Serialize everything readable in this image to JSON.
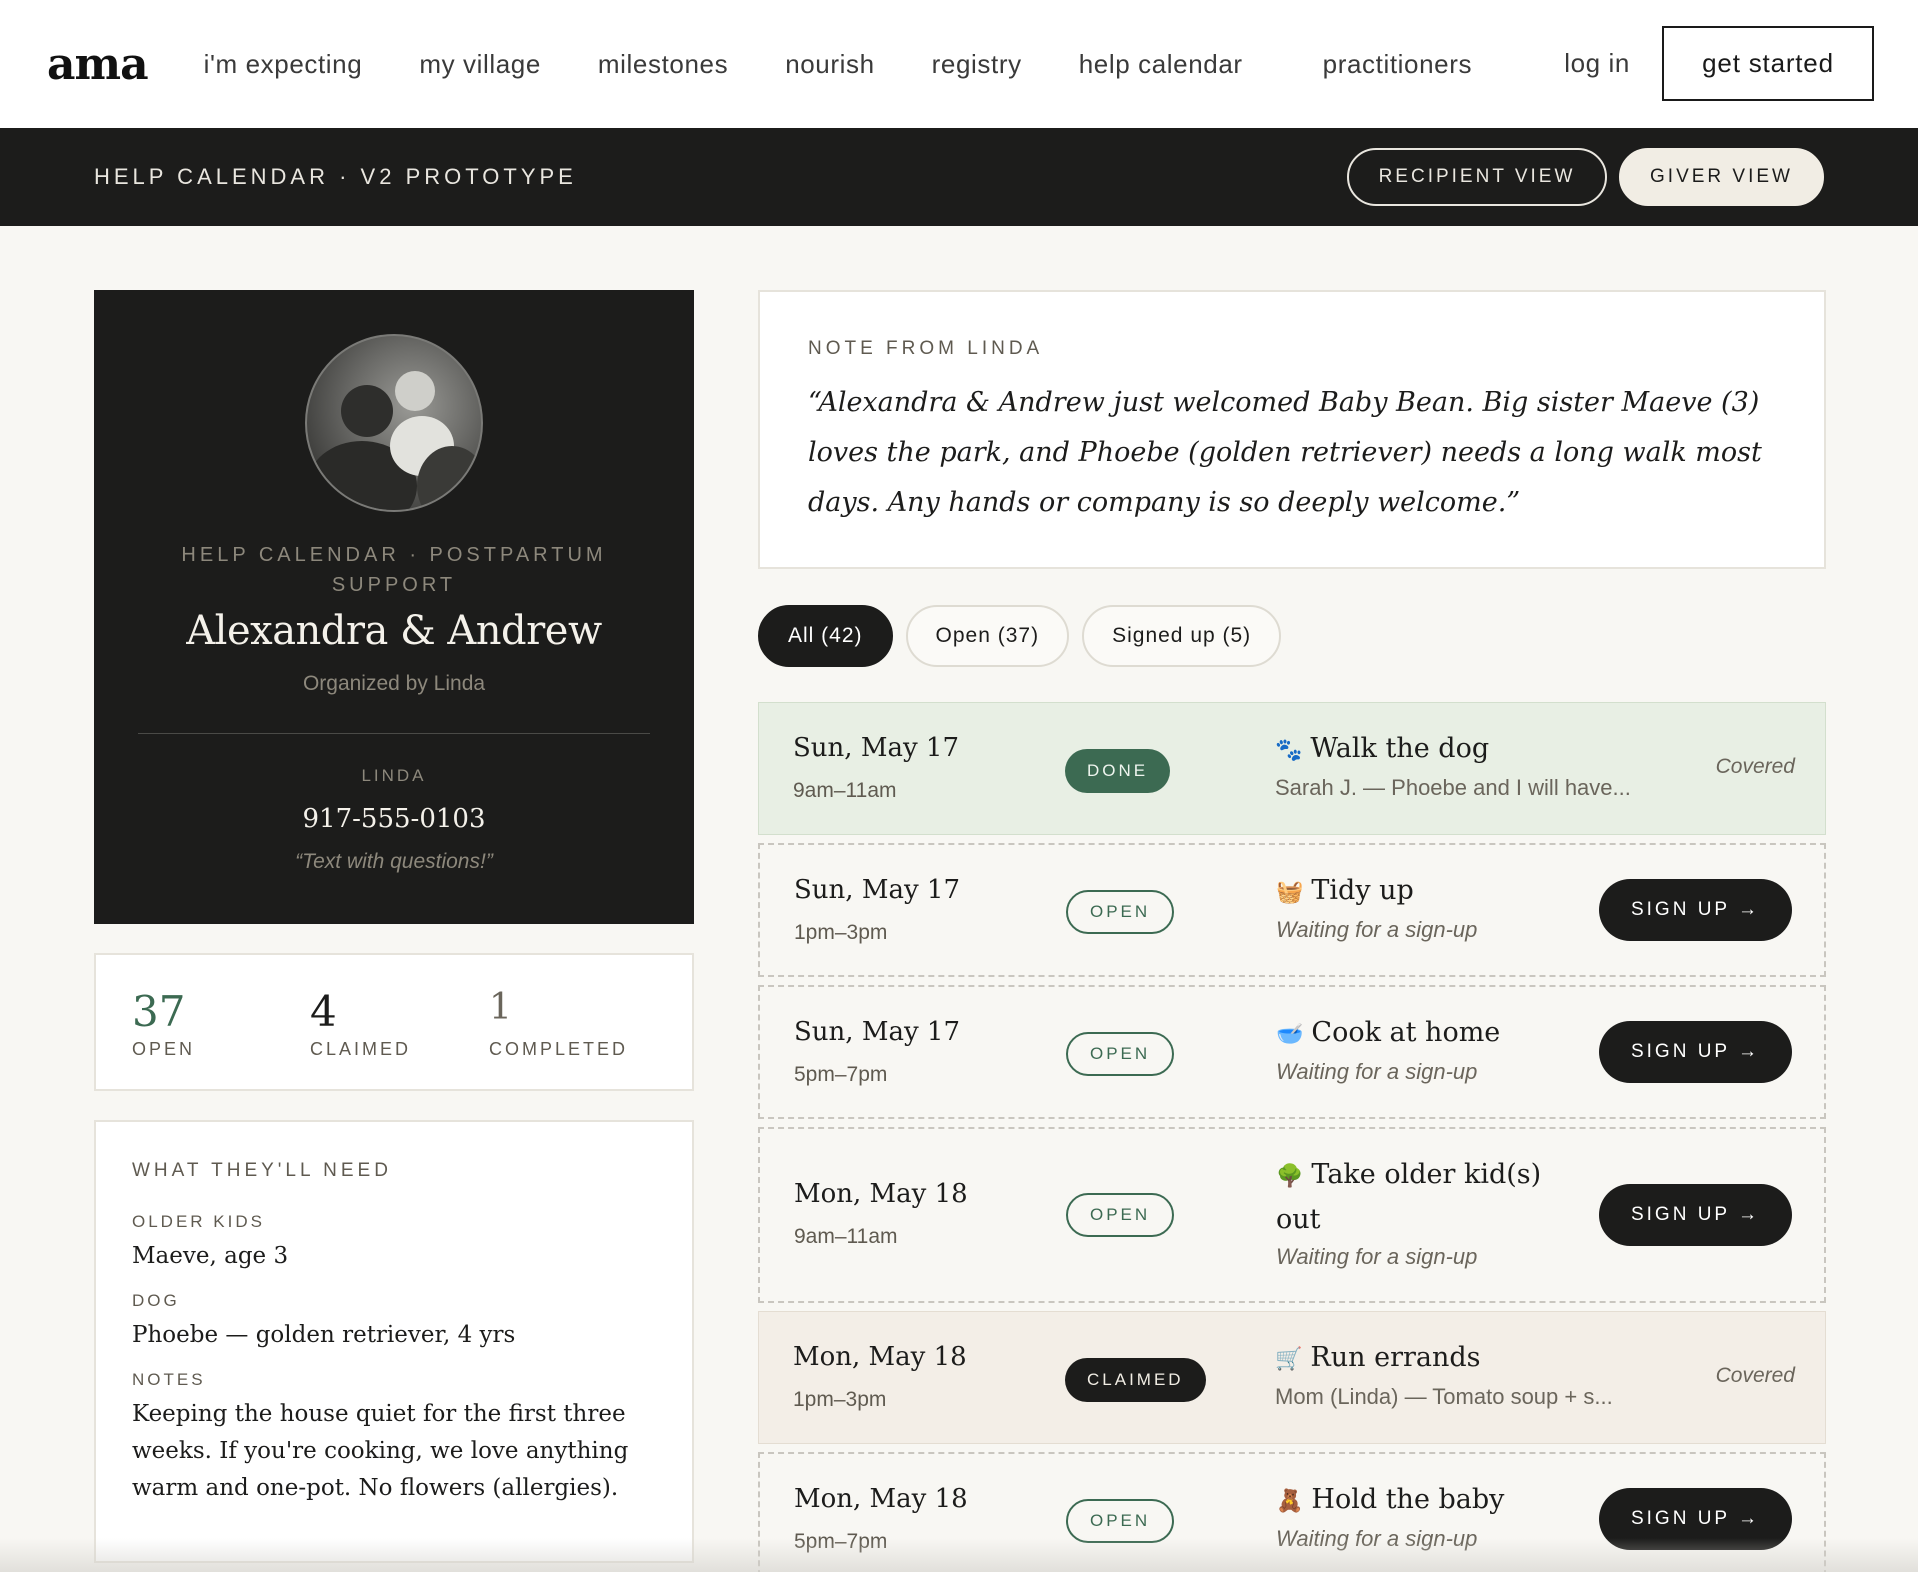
{
  "nav": {
    "logo": "ama",
    "links": [
      "i'm expecting",
      "my village",
      "milestones",
      "nourish",
      "registry",
      "help calendar",
      "practitioners"
    ],
    "login": "log in",
    "get_started": "get started"
  },
  "subbar": {
    "title": "HELP CALENDAR · V2 PROTOTYPE",
    "recipient_view": "RECIPIENT VIEW",
    "giver_view": "GIVER VIEW"
  },
  "profile": {
    "eyebrow": "HELP CALENDAR · POSTPARTUM SUPPORT",
    "name": "Alexandra & Andrew",
    "organized_by": "Organized by Linda",
    "contact_label": "LINDA",
    "contact_phone": "917-555-0103",
    "contact_note": "“Text with questions!”"
  },
  "stats": [
    {
      "value": "37",
      "label": "OPEN",
      "color": "#3c6a52"
    },
    {
      "value": "4",
      "label": "CLAIMED",
      "color": "#1c1c1b"
    },
    {
      "value": "1",
      "label": "COMPLETED",
      "color": "#6a655b"
    }
  ],
  "needs": {
    "title": "WHAT THEY'LL NEED",
    "older_kids_label": "OLDER KIDS",
    "older_kids_value": "Maeve, age 3",
    "dog_label": "DOG",
    "dog_value": "Phoebe — golden retriever, 4 yrs",
    "notes_label": "NOTES",
    "notes_value": "Keeping the house quiet for the first three weeks. If you're cooking, we love anything warm and one-pot. No flowers (allergies)."
  },
  "note": {
    "label": "NOTE FROM LINDA",
    "text": "“Alexandra & Andrew just welcomed Baby Bean. Big sister Maeve (3) loves the park, and Phoebe (golden retriever) needs a long walk most days. Any hands or company is so deeply welcome.”"
  },
  "filters": [
    "All (42)",
    "Open (37)",
    "Signed up (5)"
  ],
  "slots": [
    {
      "date": "Sun, May 17",
      "time": "9am–11am",
      "badge": "DONE",
      "emoji": "🐾",
      "title": "Walk the dog",
      "sub": "Sarah J. — Phoebe and I will have...",
      "action": "Covered"
    },
    {
      "date": "Sun, May 17",
      "time": "1pm–3pm",
      "badge": "OPEN",
      "emoji": "🧺",
      "title": "Tidy up",
      "sub": "Waiting for a sign-up",
      "action": "SIGN UP →"
    },
    {
      "date": "Sun, May 17",
      "time": "5pm–7pm",
      "badge": "OPEN",
      "emoji": "🥣",
      "title": "Cook at home",
      "sub": "Waiting for a sign-up",
      "action": "SIGN UP →"
    },
    {
      "date": "Mon, May 18",
      "time": "9am–11am",
      "badge": "OPEN",
      "emoji": "🌳",
      "title": "Take older kid(s) out",
      "sub": "Waiting for a sign-up",
      "action": "SIGN UP →"
    },
    {
      "date": "Mon, May 18",
      "time": "1pm–3pm",
      "badge": "CLAIMED",
      "emoji": "🛒",
      "title": "Run errands",
      "sub": "Mom (Linda) — Tomato soup + s...",
      "action": "Covered"
    },
    {
      "date": "Mon, May 18",
      "time": "5pm–7pm",
      "badge": "OPEN",
      "emoji": "🧸",
      "title": "Hold the baby",
      "sub": "Waiting for a sign-up",
      "action": "SIGN UP →"
    }
  ]
}
